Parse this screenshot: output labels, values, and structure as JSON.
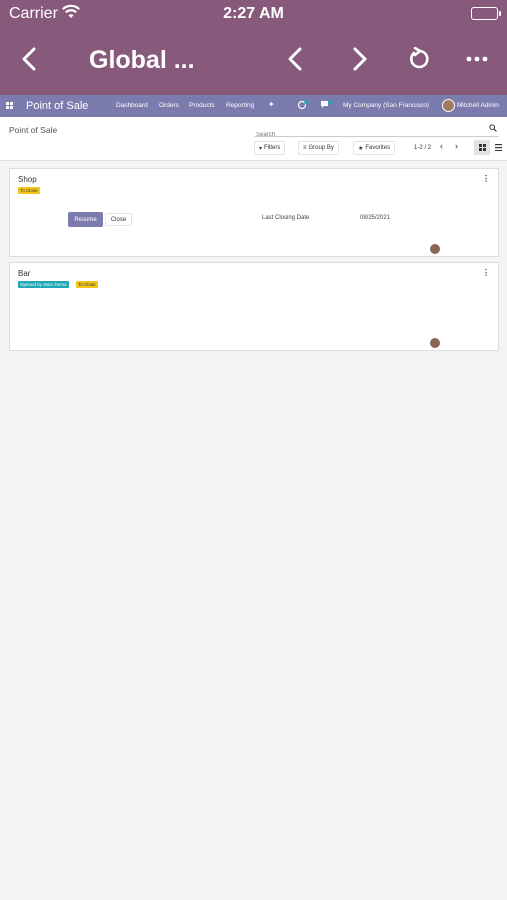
{
  "status_bar": {
    "carrier": "Carrier",
    "time": "2:27 AM"
  },
  "nav": {
    "title": "Global ...",
    "icons": [
      "back-chevron-icon",
      "previous-chevron-icon",
      "next-chevron-icon",
      "reload-icon",
      "more-icon"
    ]
  },
  "odoo": {
    "app_name": "Point of Sale",
    "menu": [
      "Dashboard",
      "Orders",
      "Products",
      "Reporting"
    ],
    "company": "My Company (San Francisco)",
    "user": "Mitchell Admin",
    "colors": {
      "topbar": "#7c7bad",
      "header": "#875a7b"
    }
  },
  "control_panel": {
    "breadcrumb": "Point of Sale",
    "search_placeholder": "Search",
    "filters": "Filters",
    "group_by": "Group By",
    "favorites": "Favorites",
    "pager": "1-2 / 2"
  },
  "cards": [
    {
      "name": "Shop",
      "badges": [
        "To Close"
      ],
      "resume": "Resume",
      "close": "Close",
      "last_closing_label": "Last Closing Date",
      "last_closing_value": "08/25/2021"
    },
    {
      "name": "Bar",
      "badges": [
        "Opened by Marc Demo",
        "To Close"
      ]
    }
  ]
}
